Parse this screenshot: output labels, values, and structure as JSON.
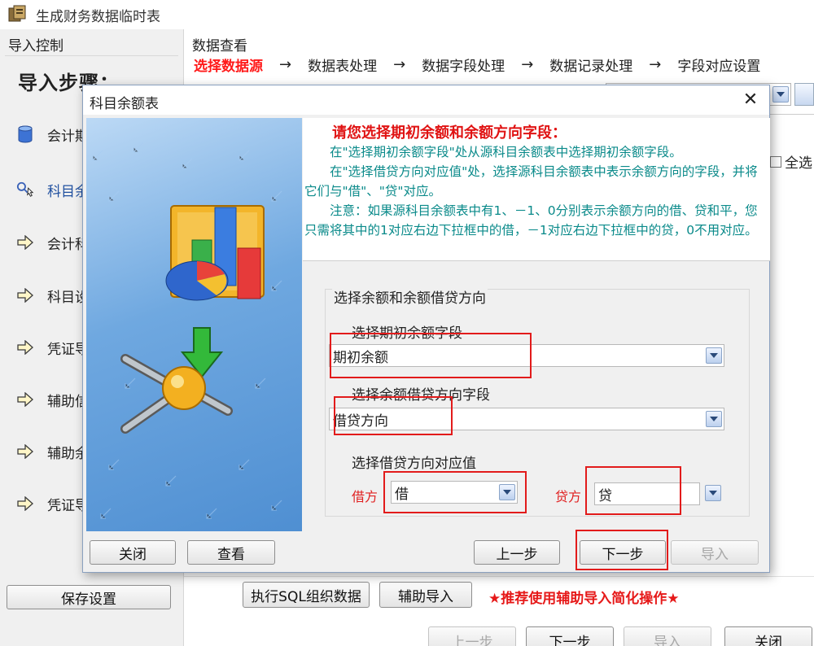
{
  "window": {
    "title": "生成财务数据临时表"
  },
  "left_panel": {
    "header": "导入控制",
    "steps_title": "导入步骤：",
    "steps": [
      {
        "label": "会计期间",
        "icon": "database-icon"
      },
      {
        "label": "科目余额",
        "icon": "search-cursor-icon"
      },
      {
        "label": "会计科目",
        "icon": "arrow-right-icon"
      },
      {
        "label": "科目设置",
        "icon": "arrow-right-icon"
      },
      {
        "label": "凭证导入",
        "icon": "arrow-right-icon"
      },
      {
        "label": "辅助信息",
        "icon": "arrow-right-icon"
      },
      {
        "label": "辅助余额",
        "icon": "arrow-right-icon"
      },
      {
        "label": "凭证导入",
        "icon": "arrow-right-icon"
      }
    ],
    "save_button": "保存设置"
  },
  "right": {
    "header": "数据查看",
    "flow": [
      "选择数据源",
      "数据表处理",
      "数据字段处理",
      "数据记录处理",
      "字段对应设置"
    ],
    "flow_arrow": "→",
    "select_all": "全选",
    "sql_button": "执行SQL组织数据",
    "aux_import_button": "辅助导入",
    "recommend": "★推荐使用辅助导入简化操作★",
    "prev_button": "上一步",
    "next_button": "下一步",
    "import_button": "导入",
    "close_button": "关闭"
  },
  "dialog": {
    "title": "科目余额表",
    "close_glyph": "✕",
    "info_title": "请您选择期初余额和余额方向字段：",
    "info_lines": [
      "在\"选择期初余额字段\"处从源科目余额表中选择期初余额字段。",
      "在\"选择借贷方向对应值\"处，选择源科目余额表中表示余额方向的字段，并将它们与\"借\"、\"贷\"对应。",
      "注意：如果源科目余额表中有1、－1、0分别表示余额方向的借、贷和平，您只需将其中的1对应右边下拉框中的借，－1对应右边下拉框中的贷，0不用对应。"
    ],
    "group_title": "选择余额和余额借贷方向",
    "opening_label": "选择期初余额字段",
    "opening_value": "期初余额",
    "direction_label": "选择余额借贷方向字段",
    "direction_value": "借贷方向",
    "mapping_label": "选择借贷方向对应值",
    "debit_label": "借方",
    "debit_value": "借",
    "credit_label": "贷方",
    "credit_value": "贷",
    "close_button": "关闭",
    "view_button": "查看",
    "prev_button": "上一步",
    "next_button": "下一步",
    "import_button": "导入"
  },
  "colors": {
    "highlight_box": "#e21b1b",
    "active_step": "#ff1a1a",
    "info_text": "#0a8a8a",
    "info_title": "#e01212"
  }
}
